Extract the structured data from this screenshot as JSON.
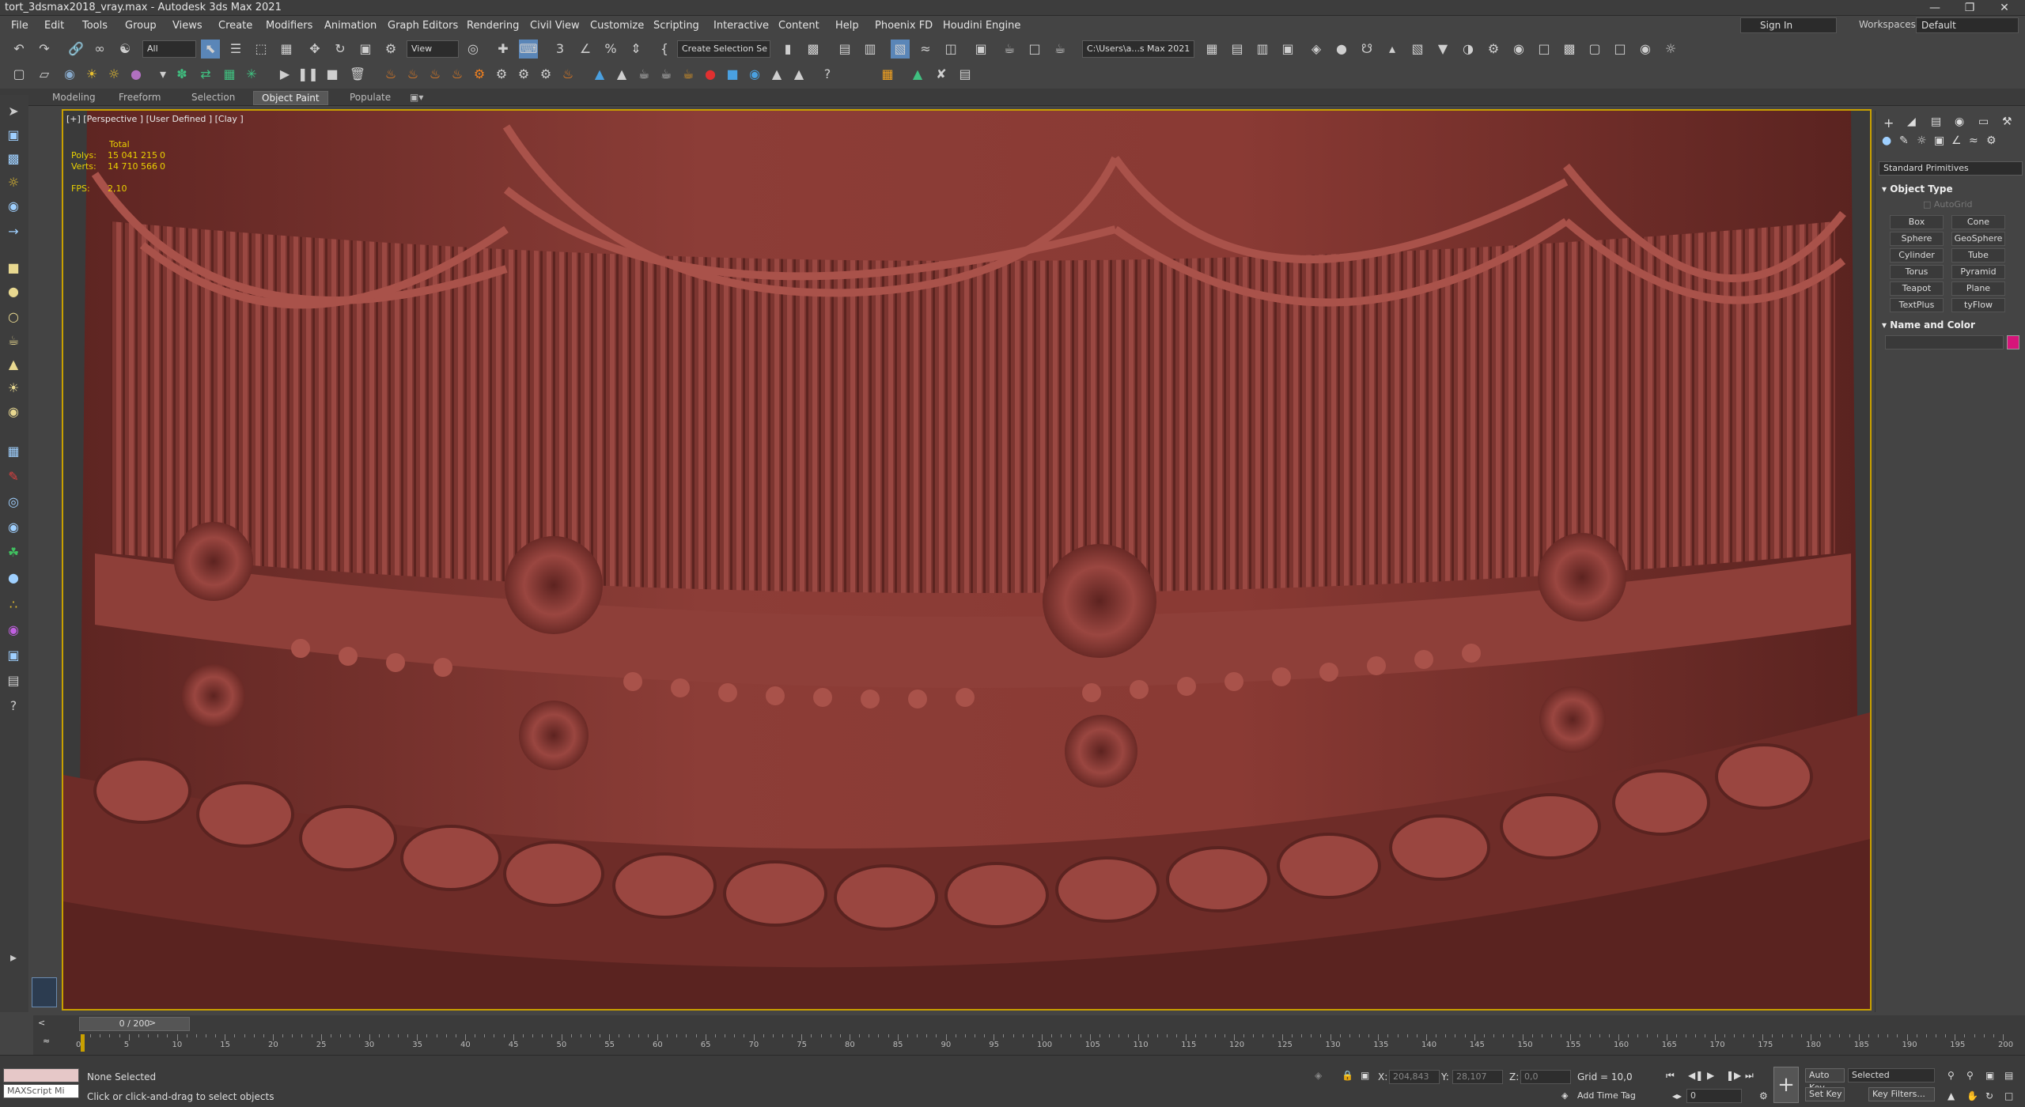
{
  "window": {
    "title": "tort_3dsmax2018_vray.max - Autodesk 3ds Max 2021"
  },
  "menu": [
    "File",
    "Edit",
    "Tools",
    "Group",
    "Views",
    "Create",
    "Modifiers",
    "Animation",
    "Graph Editors",
    "Rendering",
    "Civil View",
    "Customize",
    "Scripting",
    "Interactive",
    "Content",
    "Help",
    "Phoenix FD",
    "Houdini Engine"
  ],
  "account": {
    "signin": "Sign In",
    "workspaces_label": "Workspaces:",
    "workspace": "Default"
  },
  "toolbar": {
    "filter": "All",
    "ref_coord": "View",
    "selection_set": "Create Selection Se",
    "project_path": "C:\\Users\\a...s Max 2021"
  },
  "ribbon_tabs": [
    "Modeling",
    "Freeform",
    "Selection",
    "Object Paint",
    "Populate"
  ],
  "viewport": {
    "label": "[+] [Perspective ] [User Defined ] [Clay ]",
    "stats_total": "Total",
    "polys_label": "Polys:",
    "polys_value": "15 041 215",
    "polys_sel": "0",
    "verts_label": "Verts:",
    "verts_value": "14 710 566",
    "verts_sel": "0",
    "fps_label": "FPS:",
    "fps_value": "2,10"
  },
  "command_panel": {
    "category": "Standard Primitives",
    "object_type_title": "Object Type",
    "autogrid": "AutoGrid",
    "buttons": [
      "Box",
      "Cone",
      "Sphere",
      "GeoSphere",
      "Cylinder",
      "Tube",
      "Torus",
      "Pyramid",
      "Teapot",
      "Plane",
      "TextPlus",
      "tyFlow"
    ],
    "name_color_title": "Name and Color",
    "swatch_color": "#d6157a"
  },
  "timeline": {
    "frame": "0 / 200",
    "ticks": [
      0,
      5,
      10,
      15,
      20,
      25,
      30,
      35,
      40,
      45,
      50,
      55,
      60,
      65,
      70,
      75,
      80,
      85,
      90,
      95,
      100,
      105,
      110,
      115,
      120,
      125,
      130,
      135,
      140,
      145,
      150,
      155,
      160,
      165,
      170,
      175,
      180,
      185,
      190,
      195,
      200
    ]
  },
  "status": {
    "maxscript": "MAXScript Mi",
    "selection": "None Selected",
    "prompt": "Click or click-and-drag to select objects",
    "x_label": "X:",
    "x": "204,843",
    "y_label": "Y:",
    "y": "28,107",
    "z_label": "Z:",
    "z": "0,0",
    "grid": "Grid = 10,0",
    "add_time_tag": "Add Time Tag",
    "auto_key": "Auto Key",
    "set_key": "Set Key",
    "key_mode": "Selected",
    "key_filters": "Key Filters...",
    "current_frame": "0"
  },
  "colors": {
    "viewport_clay": "#7a3430",
    "active_frame": "#c8a000",
    "stats_text": "#e9d000"
  }
}
